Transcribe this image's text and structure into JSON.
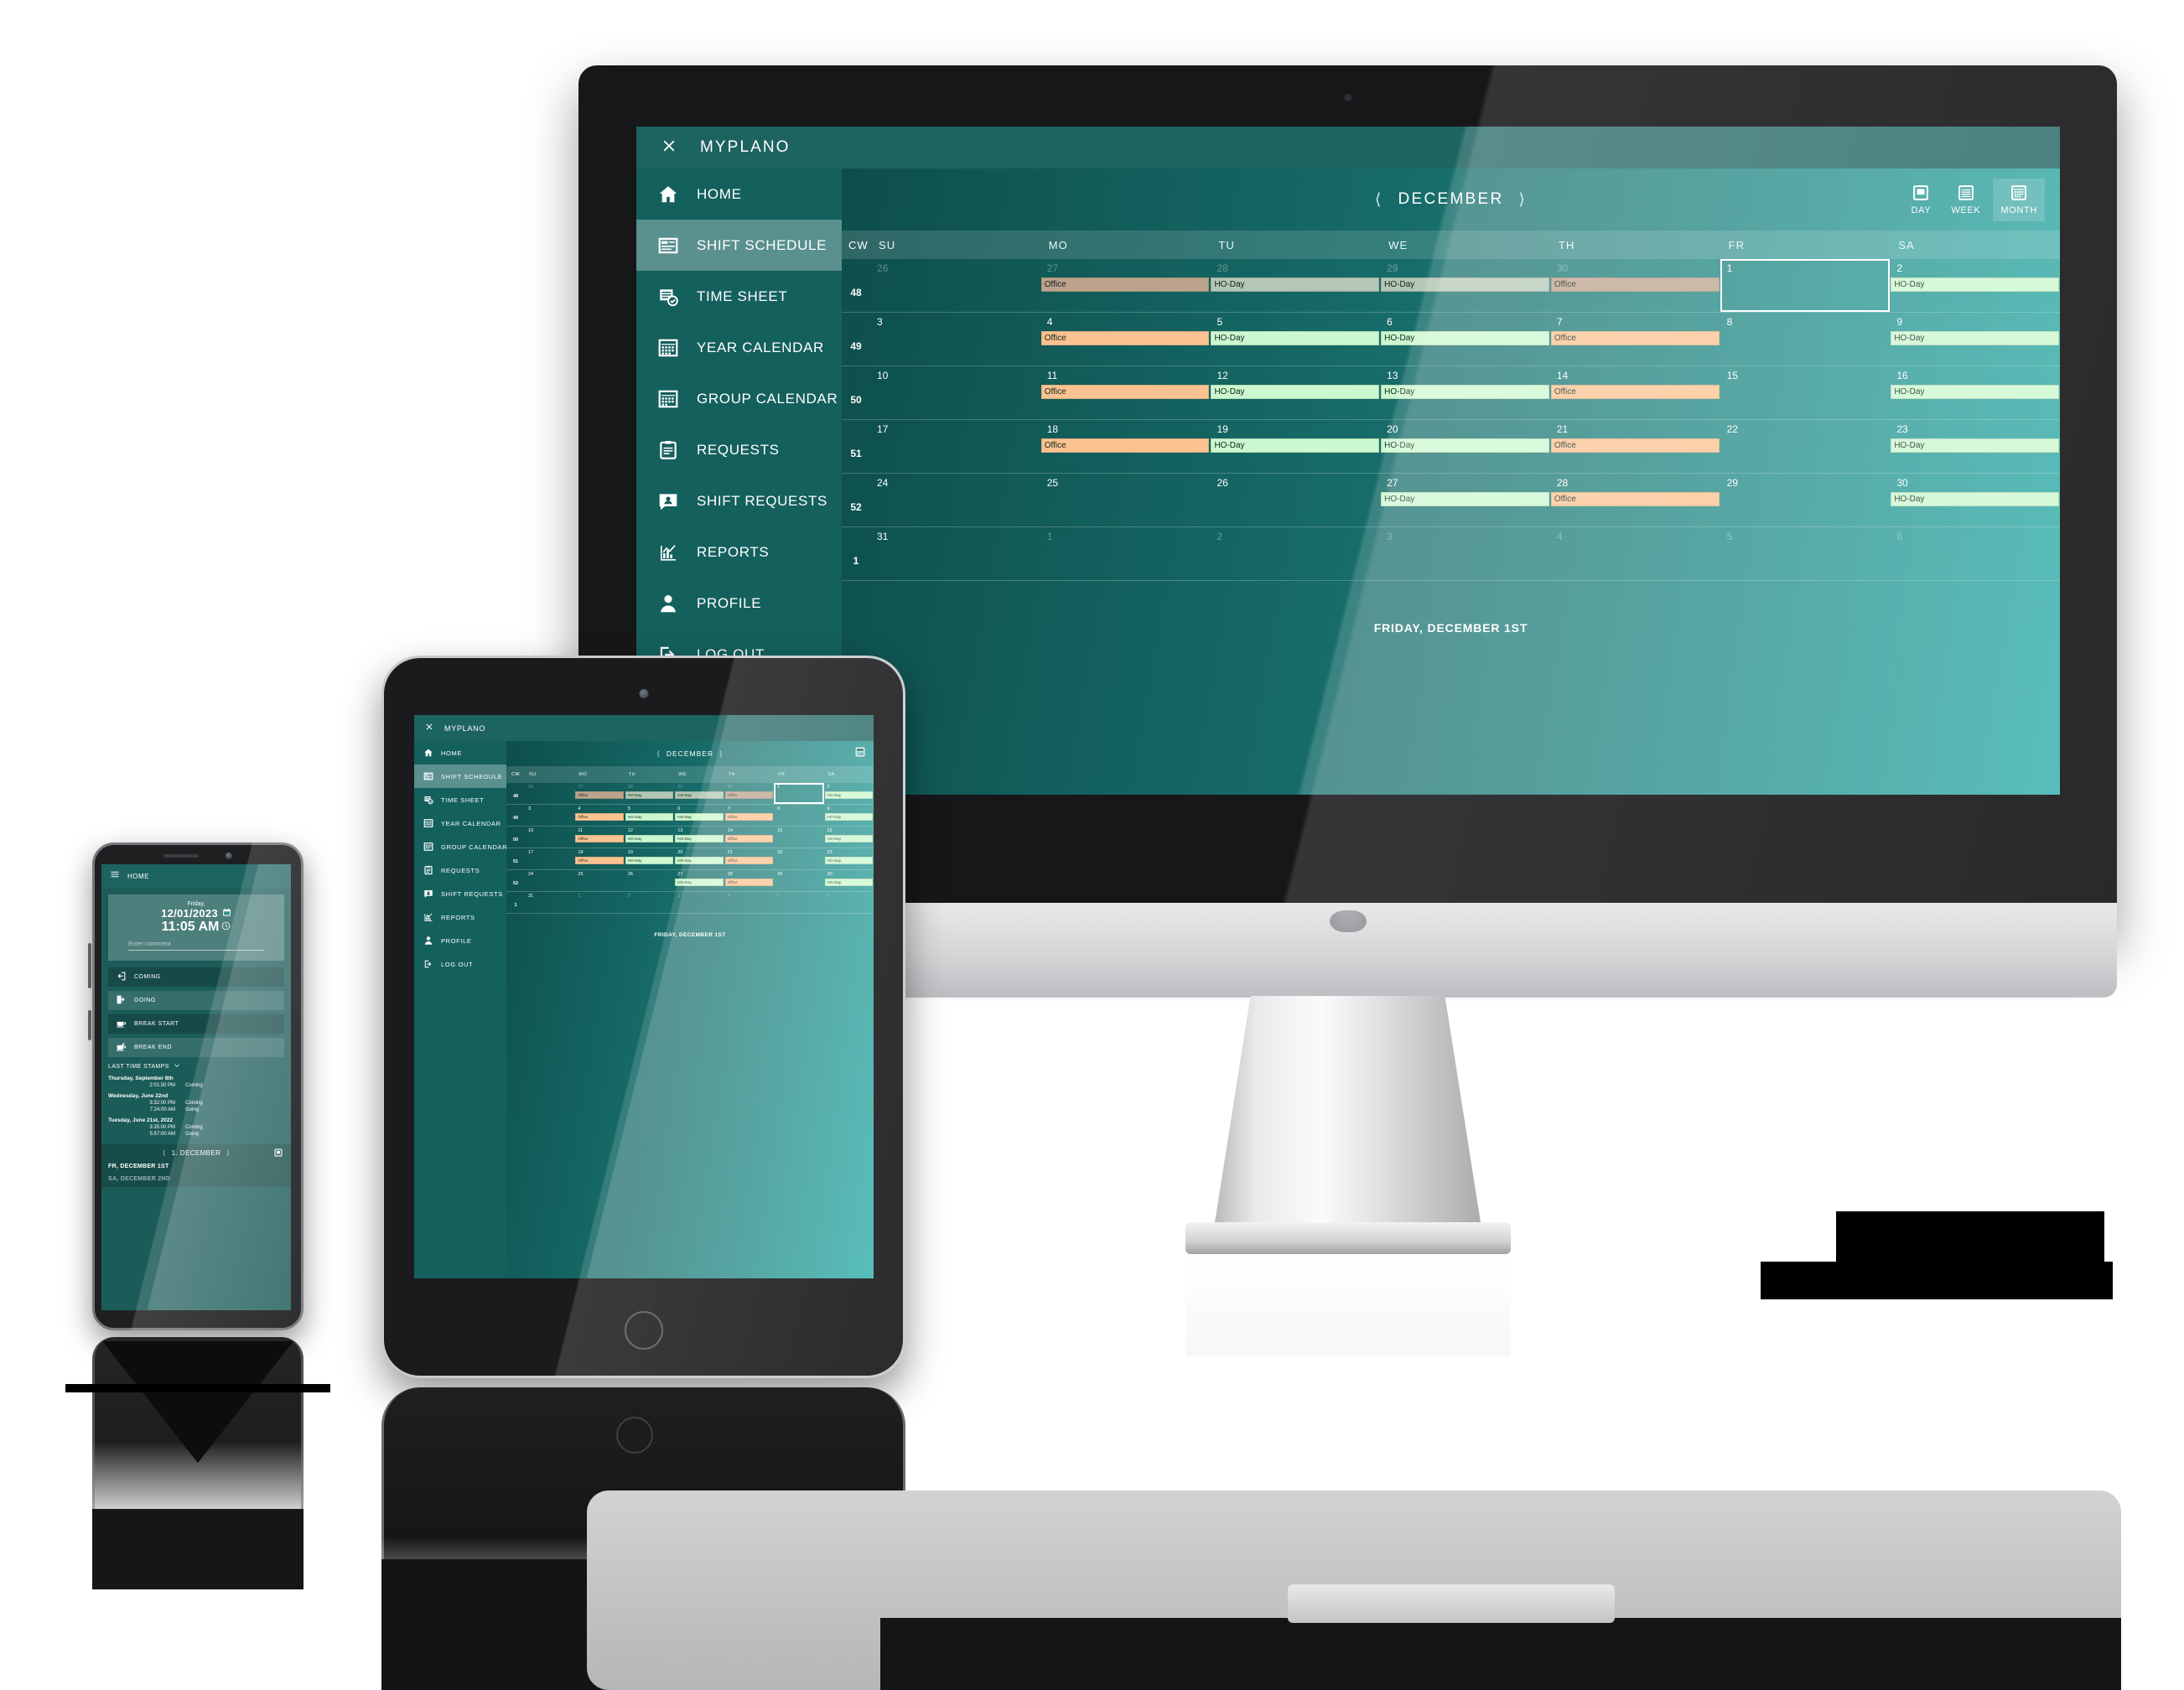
{
  "brand": {
    "app_name": "MYPLANO",
    "close_icon": "close-icon",
    "menu_icon": "hamburger-icon"
  },
  "colors": {
    "teal_dark": "#0d4e4c",
    "teal_mid": "#176d6a",
    "teal_light": "#35b0ab",
    "sidebar": "#14605d",
    "topbar": "#1d6360",
    "event_office": "#fbc391",
    "event_hoday": "#ccf8cf",
    "text_light": "#ffffff"
  },
  "sidebar": {
    "items": [
      {
        "label": "HOME",
        "icon": "home-icon",
        "active": false
      },
      {
        "label": "SHIFT SCHEDULE",
        "icon": "shift-schedule-icon",
        "active": true
      },
      {
        "label": "TIME SHEET",
        "icon": "time-sheet-icon",
        "active": false
      },
      {
        "label": "YEAR CALENDAR",
        "icon": "year-calendar-icon",
        "active": false
      },
      {
        "label": "GROUP CALENDAR",
        "icon": "group-calendar-icon",
        "active": false
      },
      {
        "label": "REQUESTS",
        "icon": "requests-clipboard-icon",
        "active": false
      },
      {
        "label": "SHIFT REQUESTS",
        "icon": "shift-requests-icon",
        "active": false
      },
      {
        "label": "REPORTS",
        "icon": "reports-chart-icon",
        "active": false
      },
      {
        "label": "PROFILE",
        "icon": "profile-person-icon",
        "active": false
      },
      {
        "label": "LOG OUT",
        "icon": "logout-icon",
        "active": false
      }
    ]
  },
  "calendar": {
    "month_label": "DECEMBER",
    "prev_icon": "chevron-left-icon",
    "next_icon": "chevron-right-icon",
    "view_toggle": [
      {
        "label": "DAY",
        "icon": "day-view-icon",
        "selected": false
      },
      {
        "label": "WEEK",
        "icon": "week-view-icon",
        "selected": false
      },
      {
        "label": "MONTH",
        "icon": "month-view-icon",
        "selected": true
      }
    ],
    "columns": [
      "CW",
      "SU",
      "MO",
      "TU",
      "WE",
      "TH",
      "FR",
      "SA"
    ],
    "footer_label": "FRIDAY, DECEMBER 1ST",
    "weeks": [
      {
        "cw": "48",
        "days": [
          {
            "num": "26",
            "out": true,
            "event": null,
            "selected": false
          },
          {
            "num": "27",
            "out": true,
            "event": "Office",
            "selected": false
          },
          {
            "num": "28",
            "out": true,
            "event": "HO-Day",
            "selected": false
          },
          {
            "num": "29",
            "out": true,
            "event": "HO-Day",
            "selected": false
          },
          {
            "num": "30",
            "out": true,
            "event": "Office",
            "selected": false
          },
          {
            "num": "1",
            "out": false,
            "event": null,
            "selected": true
          },
          {
            "num": "2",
            "out": false,
            "event": "HO-Day",
            "selected": false
          }
        ]
      },
      {
        "cw": "49",
        "days": [
          {
            "num": "3",
            "out": false,
            "event": null,
            "selected": false
          },
          {
            "num": "4",
            "out": false,
            "event": "Office",
            "selected": false
          },
          {
            "num": "5",
            "out": false,
            "event": "HO-Day",
            "selected": false
          },
          {
            "num": "6",
            "out": false,
            "event": "HO-Day",
            "selected": false
          },
          {
            "num": "7",
            "out": false,
            "event": "Office",
            "selected": false
          },
          {
            "num": "8",
            "out": false,
            "event": null,
            "selected": false
          },
          {
            "num": "9",
            "out": false,
            "event": "HO-Day",
            "selected": false
          }
        ]
      },
      {
        "cw": "50",
        "days": [
          {
            "num": "10",
            "out": false,
            "event": null,
            "selected": false
          },
          {
            "num": "11",
            "out": false,
            "event": "Office",
            "selected": false
          },
          {
            "num": "12",
            "out": false,
            "event": "HO-Day",
            "selected": false
          },
          {
            "num": "13",
            "out": false,
            "event": "HO-Day",
            "selected": false
          },
          {
            "num": "14",
            "out": false,
            "event": "Office",
            "selected": false
          },
          {
            "num": "15",
            "out": false,
            "event": null,
            "selected": false
          },
          {
            "num": "16",
            "out": false,
            "event": "HO-Day",
            "selected": false
          }
        ]
      },
      {
        "cw": "51",
        "days": [
          {
            "num": "17",
            "out": false,
            "event": null,
            "selected": false
          },
          {
            "num": "18",
            "out": false,
            "event": "Office",
            "selected": false
          },
          {
            "num": "19",
            "out": false,
            "event": "HO-Day",
            "selected": false
          },
          {
            "num": "20",
            "out": false,
            "event": "HO-Day",
            "selected": false
          },
          {
            "num": "21",
            "out": false,
            "event": "Office",
            "selected": false
          },
          {
            "num": "22",
            "out": false,
            "event": null,
            "selected": false
          },
          {
            "num": "23",
            "out": false,
            "event": "HO-Day",
            "selected": false
          }
        ]
      },
      {
        "cw": "52",
        "days": [
          {
            "num": "24",
            "out": false,
            "event": null,
            "selected": false
          },
          {
            "num": "25",
            "out": false,
            "event": null,
            "selected": false
          },
          {
            "num": "26",
            "out": false,
            "event": null,
            "selected": false
          },
          {
            "num": "27",
            "out": false,
            "event": "HO-Day",
            "selected": false
          },
          {
            "num": "28",
            "out": false,
            "event": "Office",
            "selected": false
          },
          {
            "num": "29",
            "out": false,
            "event": null,
            "selected": false
          },
          {
            "num": "30",
            "out": false,
            "event": "HO-Day",
            "selected": false
          }
        ]
      },
      {
        "cw": "1",
        "days": [
          {
            "num": "31",
            "out": false,
            "event": null,
            "selected": false
          },
          {
            "num": "1",
            "out": true,
            "event": null,
            "selected": false
          },
          {
            "num": "2",
            "out": true,
            "event": null,
            "selected": false
          },
          {
            "num": "3",
            "out": true,
            "event": null,
            "selected": false
          },
          {
            "num": "4",
            "out": true,
            "event": null,
            "selected": false
          },
          {
            "num": "5",
            "out": true,
            "event": null,
            "selected": false
          },
          {
            "num": "6",
            "out": true,
            "event": null,
            "selected": false
          }
        ]
      }
    ]
  },
  "tablet": {
    "calendar_icon": "calendar-view-icon"
  },
  "phone": {
    "title": "HOME",
    "menu_icon": "hamburger-icon",
    "clock": {
      "weekday": "Friday,",
      "date": "12/01/2023",
      "date_icon": "calendar-icon",
      "time": "11:05 AM",
      "time_icon": "clock-icon",
      "comment_placeholder": "Enter comment"
    },
    "actions": [
      {
        "label": "COMING",
        "icon": "arrow-into-door-icon"
      },
      {
        "label": "GOING",
        "icon": "arrow-out-door-icon"
      },
      {
        "label": "BREAK START",
        "icon": "coffee-cup-icon"
      },
      {
        "label": "BREAK END",
        "icon": "coffee-cup-crossed-icon"
      }
    ],
    "stamps": {
      "header": "LAST TIME STAMPS",
      "chevron_icon": "chevron-down-icon",
      "groups": [
        {
          "day": "Thursday, September 8th",
          "entries": [
            {
              "time": "2:01:30 PM",
              "type": "Coming"
            }
          ]
        },
        {
          "day": "Wednesday, June 22nd",
          "entries": [
            {
              "time": "3:32:00 PM",
              "type": "Coming"
            },
            {
              "time": "7:24:00 AM",
              "type": "Going"
            }
          ]
        },
        {
          "day": "Tuesday, June 21st, 2022",
          "entries": [
            {
              "time": "3:35:00 PM",
              "type": "Coming"
            },
            {
              "time": "5:57:00 AM",
              "type": "Going"
            }
          ]
        }
      ]
    },
    "schedule": {
      "nav_label": "1. DECEMBER",
      "prev_icon": "chevron-left-icon",
      "next_icon": "chevron-right-icon",
      "view_icon": "day-view-icon",
      "items": [
        {
          "label": "FR, DECEMBER 1ST",
          "dim": false
        },
        {
          "label": "SA, DECEMBER 2ND",
          "dim": true
        }
      ]
    }
  }
}
